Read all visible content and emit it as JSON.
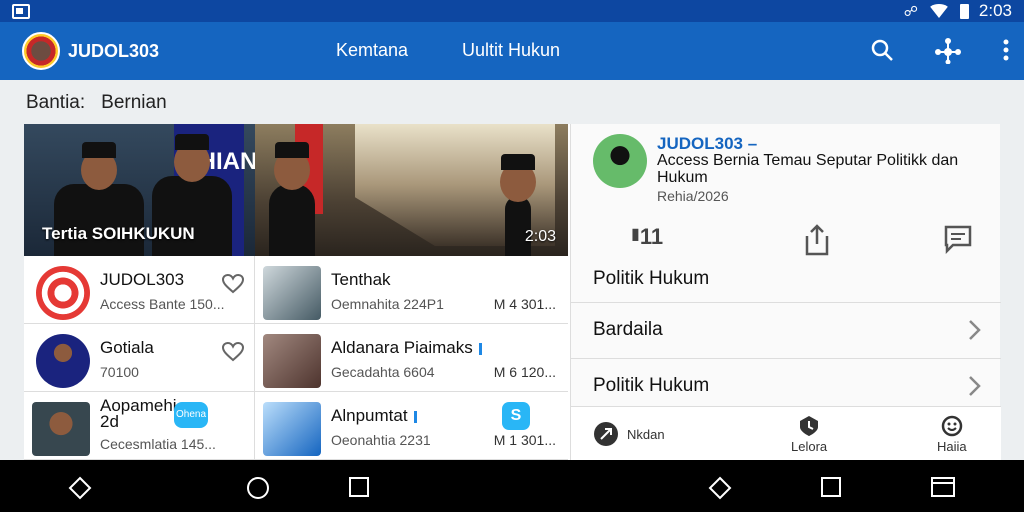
{
  "status_bar": {
    "time": "2:03"
  },
  "app_bar": {
    "title": "JUDOL303",
    "nav": [
      "Kemtana",
      "Uultit Hukun"
    ]
  },
  "breadcrumb": {
    "label": "Bantia:",
    "value": "Bernian"
  },
  "hero": {
    "caption": "Tertia SOIHKUKUN",
    "time": "2:03",
    "banner_text": "THIAN"
  },
  "news": [
    {
      "title": "JUDOL303",
      "sub": "Access Bante 150...",
      "meta": ""
    },
    {
      "title": "Tenthak",
      "sub": "Oemnahita 224P1",
      "meta": "M 4 301..."
    },
    {
      "title": "Gotiala",
      "sub": "70100",
      "meta": ""
    },
    {
      "title": "Aldanara Piaimaks",
      "sub": "Gecadahta 6604",
      "meta": "M 6 120..."
    },
    {
      "title": "Aopamehi 2d",
      "sub": "Cecesmlatia 145...",
      "meta": "",
      "badge": "Ohena"
    },
    {
      "title": "Alnpumtat",
      "sub": "Oeonahtia 2231",
      "meta": "M 1 301...",
      "badge": "S"
    }
  ],
  "detail": {
    "brand": "JUDOL303 –",
    "heading": "Access Bernia Temau Seputar Politikk dan Hukum",
    "date": "Rehia/2026",
    "action_count": "11",
    "category": "Politik Hukum",
    "rows": [
      "Bardaila",
      "Politik Hukum"
    ],
    "bottom_nav": [
      "Nkdan",
      "Lelora",
      "Haiia"
    ]
  },
  "colors": {
    "primary": "#1565c0",
    "primary_dark": "#0d47a1",
    "accent": "#29b6f6"
  }
}
